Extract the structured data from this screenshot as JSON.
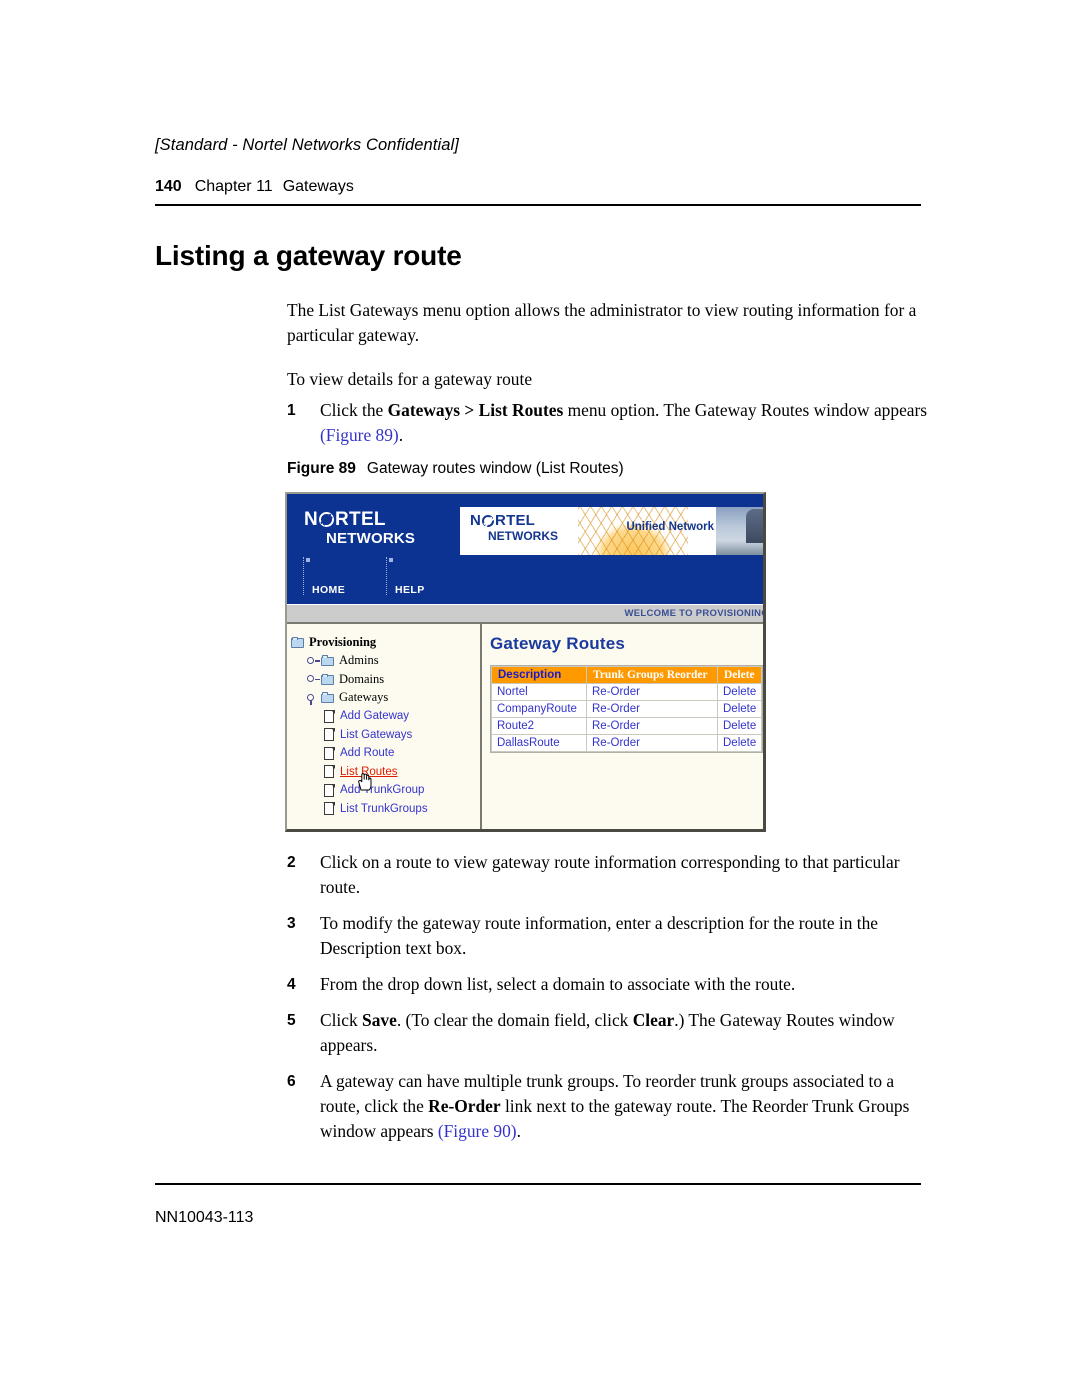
{
  "header": {
    "confidential": "[Standard - Nortel Networks Confidential]",
    "page_number": "140",
    "chapter": "Chapter 11",
    "chapter_name": "Gateways",
    "title": "Listing a gateway route"
  },
  "body": {
    "intro": "The List Gateways menu option allows the administrator to view routing information for a particular gateway.",
    "lead_in": "To view details for a gateway route"
  },
  "steps": [
    {
      "num": "1",
      "parts": [
        {
          "text": "Click the ",
          "style": "normal"
        },
        {
          "text": "Gateways > List Routes",
          "style": "bold"
        },
        {
          "text": " menu option. The Gateway Routes window appears ",
          "style": "normal"
        },
        {
          "text": "(Figure 89)",
          "style": "xref"
        },
        {
          "text": ".",
          "style": "normal"
        }
      ]
    },
    {
      "num": "2",
      "parts": [
        {
          "text": "Click on a route to view gateway route information corresponding to that particular route.",
          "style": "normal"
        }
      ]
    },
    {
      "num": "3",
      "parts": [
        {
          "text": "To modify the gateway route information, enter a description for the route in the Description text box.",
          "style": "normal"
        }
      ]
    },
    {
      "num": "4",
      "parts": [
        {
          "text": "From the drop down list, select a domain to associate with the route.",
          "style": "normal"
        }
      ]
    },
    {
      "num": "5",
      "parts": [
        {
          "text": "Click ",
          "style": "normal"
        },
        {
          "text": "Save",
          "style": "bold"
        },
        {
          "text": ". (To clear the domain field, click ",
          "style": "normal"
        },
        {
          "text": "Clear",
          "style": "bold"
        },
        {
          "text": ".) The Gateway Routes window appears.",
          "style": "normal"
        }
      ]
    },
    {
      "num": "6",
      "parts": [
        {
          "text": "A gateway can have multiple trunk groups. To reorder trunk groups associated to a route, click the ",
          "style": "normal"
        },
        {
          "text": "Re-Order",
          "style": "bold"
        },
        {
          "text": " link next to the gateway route. The Reorder Trunk Groups window appears ",
          "style": "normal"
        },
        {
          "text": "(Figure 90)",
          "style": "xref"
        },
        {
          "text": ".",
          "style": "normal"
        }
      ]
    }
  ],
  "figure": {
    "caption_number": "Figure 89",
    "caption_text": "Gateway routes window (List Routes)",
    "screenshot": {
      "logo": {
        "pre": "N",
        "post": "RTEL",
        "line2": "NETWORKS"
      },
      "banner": {
        "logo_pre": "N",
        "logo_post": "RTEL",
        "logo_line2": "NETWORKS",
        "tagline": "Unified Network"
      },
      "nav": [
        {
          "label": "HOME"
        },
        {
          "label": "HELP"
        }
      ],
      "welcome": "WELCOME TO PROVISIONING",
      "tree": {
        "root": "Provisioning",
        "folders": [
          {
            "label": "Admins",
            "state": "collapsed"
          },
          {
            "label": "Domains",
            "state": "collapsed"
          },
          {
            "label": "Gateways",
            "state": "expanded"
          }
        ],
        "leaves": [
          {
            "label": "Add Gateway",
            "selected": false
          },
          {
            "label": "List Gateways",
            "selected": false
          },
          {
            "label": "Add Route",
            "selected": false
          },
          {
            "label": "List Routes",
            "selected": true
          },
          {
            "label": "Add TrunkGroup",
            "selected": false
          },
          {
            "label": "List TrunkGroups",
            "selected": false
          }
        ]
      },
      "content": {
        "title": "Gateway Routes",
        "table": {
          "columns": [
            "Description",
            "Trunk Groups Reorder",
            "Delete"
          ],
          "rows": [
            {
              "description": "Nortel",
              "reorder": "Re-Order",
              "delete": "Delete"
            },
            {
              "description": "CompanyRoute",
              "reorder": "Re-Order",
              "delete": "Delete"
            },
            {
              "description": "Route2",
              "reorder": "Re-Order",
              "delete": "Delete"
            },
            {
              "description": "DallasRoute",
              "reorder": "Re-Order",
              "delete": "Delete"
            }
          ]
        }
      }
    }
  },
  "footer": {
    "code": "NN10043-113"
  },
  "colors": {
    "nortel_blue": "#0d3392",
    "header_orange": "#ff9900",
    "link_blue": "#3333cc",
    "selected_red": "#e01b00",
    "title_blue": "#1a3a9e"
  }
}
